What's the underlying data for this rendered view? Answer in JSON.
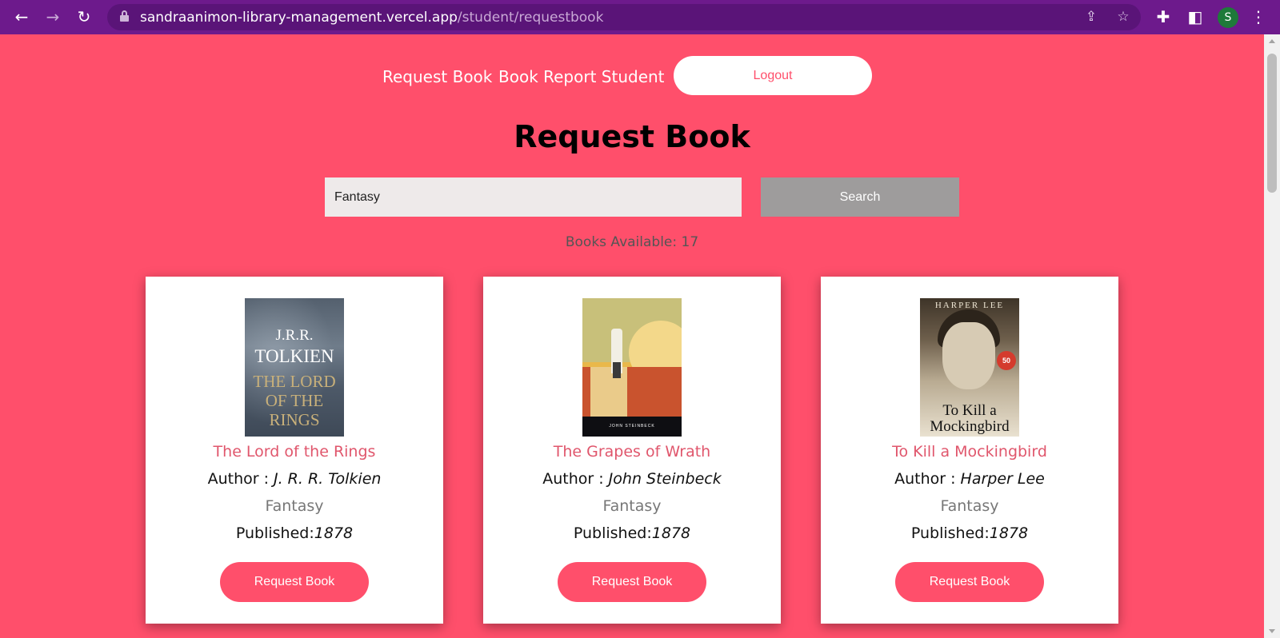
{
  "browser": {
    "url_host": "sandraanimon-library-management.vercel.app",
    "url_path": "/student/requestbook",
    "avatar_letter": "S",
    "icons": [
      "back-arrow-icon",
      "forward-arrow-icon",
      "reload-icon",
      "lock-icon",
      "share-icon",
      "star-icon",
      "puzzle-icon",
      "side-panel-icon",
      "more-icon"
    ]
  },
  "nav": {
    "request_book": "Request Book",
    "book_report_student": "Book Report Student",
    "logout": "Logout"
  },
  "page_title": "Request Book",
  "search": {
    "value": "Fantasy",
    "button": "Search"
  },
  "books_available_text": "Books Available: 17",
  "books": [
    {
      "title": "The Lord of the Rings",
      "author_label": "Author :",
      "author": "J. R. R. Tolkien",
      "genre": "Fantasy",
      "published_label": "Published:",
      "published": "1878",
      "button": "Request Book",
      "cover_text_1": "J.R.R.",
      "cover_text_2": "TOLKIEN",
      "cover_text_3": "THE LORD OF THE RINGS"
    },
    {
      "title": "The Grapes of Wrath",
      "author_label": "Author :",
      "author": "John Steinbeck",
      "genre": "Fantasy",
      "published_label": "Published:",
      "published": "1878",
      "button": "Request Book",
      "cover_text_1": "JOHN STEINBECK"
    },
    {
      "title": "To Kill a Mockingbird",
      "author_label": "Author :",
      "author": "Harper Lee",
      "genre": "Fantasy",
      "published_label": "Published:",
      "published": "1878",
      "button": "Request Book",
      "cover_text_1": "HARPER LEE",
      "cover_text_2": "To Kill a Mockingbird",
      "cover_badge": "50"
    }
  ],
  "colors": {
    "page_background": "#ff4f6b",
    "browser_bar": "#6d1a8c",
    "title_link": "#e0566c",
    "search_button": "#9e9c9c"
  }
}
